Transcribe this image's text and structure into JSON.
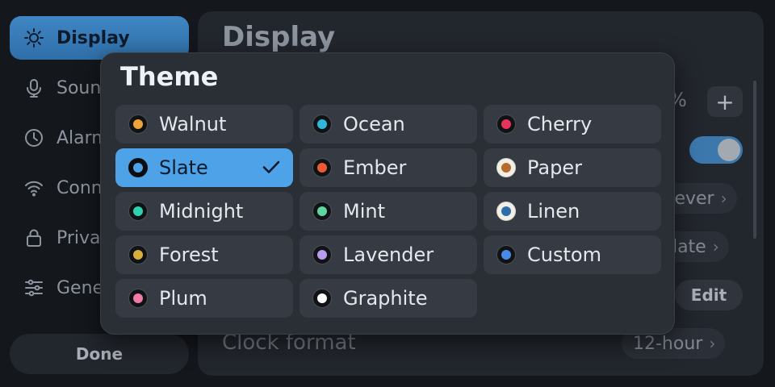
{
  "sidebar": {
    "items": [
      {
        "label": "Display",
        "icon": "sun-icon",
        "active": true
      },
      {
        "label": "Sound",
        "icon": "microphone-icon"
      },
      {
        "label": "Alarms",
        "icon": "clock-icon"
      },
      {
        "label": "Connectivity",
        "icon": "wifi-icon"
      },
      {
        "label": "Privacy",
        "icon": "lock-icon"
      },
      {
        "label": "General",
        "icon": "sliders-icon"
      }
    ],
    "done_label": "Done"
  },
  "panel": {
    "title": "Display",
    "brightness_suffix": "%",
    "plus_label": "+",
    "sleep_value": "Never",
    "theme_value": "Slate",
    "edit_label": "Edit",
    "clock_label": "Clock format",
    "clock_value": "12-hour"
  },
  "popover": {
    "title": "Theme",
    "selected": "Slate",
    "options": [
      {
        "label": "Walnut",
        "color": "#f0a23a"
      },
      {
        "label": "Ocean",
        "color": "#2fb6d8"
      },
      {
        "label": "Cherry",
        "color": "#e8335a"
      },
      {
        "label": "Slate",
        "color": "#4ea3e8"
      },
      {
        "label": "Ember",
        "color": "#ee5a32"
      },
      {
        "label": "Paper",
        "color": "#b8692c",
        "light": true
      },
      {
        "label": "Midnight",
        "color": "#2fd2b0"
      },
      {
        "label": "Mint",
        "color": "#5fd6a2"
      },
      {
        "label": "Linen",
        "color": "#2e6ea8",
        "light": true
      },
      {
        "label": "Forest",
        "color": "#d8b03a"
      },
      {
        "label": "Lavender",
        "color": "#b89cf0"
      },
      {
        "label": "Custom",
        "color": "#4a8ae8"
      },
      {
        "label": "Plum",
        "color": "#f07aa8"
      },
      {
        "label": "Graphite",
        "color": "#ffffff"
      }
    ]
  },
  "colors": {
    "accent": "#4ea3e8",
    "sidebar_active": "#3a80bd",
    "toggle_on": "#3d78ad"
  }
}
